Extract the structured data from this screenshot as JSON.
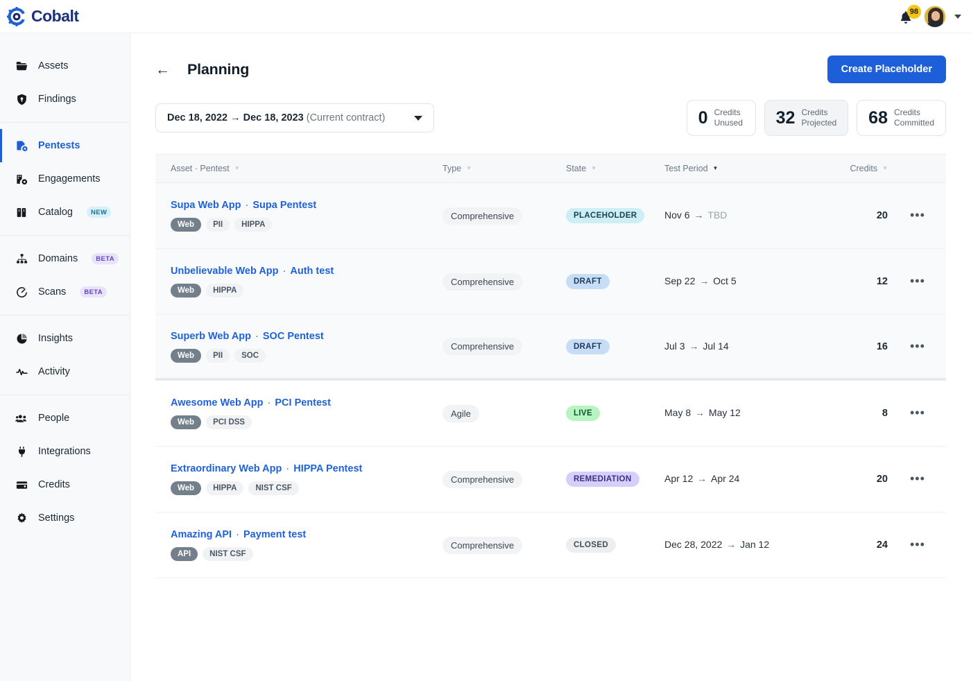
{
  "topbar": {
    "brand_name": "Cobalt",
    "notification_count": "98"
  },
  "sidebar": {
    "groups": [
      {
        "items": [
          {
            "label": "Assets",
            "icon": "folder-icon",
            "active": false,
            "tag": ""
          },
          {
            "label": "Findings",
            "icon": "shield-icon",
            "active": false,
            "tag": ""
          }
        ]
      },
      {
        "items": [
          {
            "label": "Pentests",
            "icon": "pentest-icon",
            "active": true,
            "tag": ""
          },
          {
            "label": "Engagements",
            "icon": "engagements-icon",
            "active": false,
            "tag": ""
          },
          {
            "label": "Catalog",
            "icon": "catalog-icon",
            "active": false,
            "tag": "NEW",
            "tag_kind": "new"
          }
        ]
      },
      {
        "items": [
          {
            "label": "Domains",
            "icon": "sitemap-icon",
            "active": false,
            "tag": "BETA",
            "tag_kind": "beta"
          },
          {
            "label": "Scans",
            "icon": "scan-icon",
            "active": false,
            "tag": "BETA",
            "tag_kind": "beta"
          }
        ]
      },
      {
        "items": [
          {
            "label": "Insights",
            "icon": "pie-chart-icon",
            "active": false,
            "tag": ""
          },
          {
            "label": "Activity",
            "icon": "activity-pulse-icon",
            "active": false,
            "tag": ""
          }
        ]
      },
      {
        "items": [
          {
            "label": "People",
            "icon": "people-icon",
            "active": false,
            "tag": ""
          },
          {
            "label": "Integrations",
            "icon": "plug-icon",
            "active": false,
            "tag": ""
          },
          {
            "label": "Credits",
            "icon": "wallet-icon",
            "active": false,
            "tag": ""
          },
          {
            "label": "Settings",
            "icon": "gear-icon",
            "active": false,
            "tag": ""
          }
        ]
      }
    ]
  },
  "page": {
    "title": "Planning",
    "create_button": "Create Placeholder",
    "date_range_main": "Dec 18, 2022 → Dec 18, 2023",
    "date_range_sub": "(Current contract)"
  },
  "credit_cards": [
    {
      "value": "0",
      "line1": "Credits",
      "line2": "Unused",
      "muted": false
    },
    {
      "value": "32",
      "line1": "Credits",
      "line2": "Projected",
      "muted": true
    },
    {
      "value": "68",
      "line1": "Credits",
      "line2": "Committed",
      "muted": false
    }
  ],
  "table": {
    "columns": [
      {
        "label": "Asset · Pentest",
        "sorted": false
      },
      {
        "label": "Type",
        "sorted": false
      },
      {
        "label": "State",
        "sorted": false
      },
      {
        "label": "Test Period",
        "sorted": true
      },
      {
        "label": "Credits",
        "sorted": false
      }
    ],
    "rows": [
      {
        "asset": "Supa Web App",
        "pentest": "Supa Pentest",
        "tags": [
          {
            "label": "Web",
            "solid": true
          },
          {
            "label": "PII",
            "solid": false
          },
          {
            "label": "HIPPA",
            "solid": false
          }
        ],
        "type": "Comprehensive",
        "state": "PLACEHOLDER",
        "state_class": "st-placeholder",
        "period_start": "Nov 6",
        "period_end": "TBD",
        "period_end_muted": true,
        "credits": "20",
        "shaded": true,
        "group_end": false
      },
      {
        "asset": "Unbelievable Web App",
        "pentest": "Auth test",
        "tags": [
          {
            "label": "Web",
            "solid": true
          },
          {
            "label": "HIPPA",
            "solid": false
          }
        ],
        "type": "Comprehensive",
        "state": "DRAFT",
        "state_class": "st-draft",
        "period_start": "Sep 22",
        "period_end": "Oct 5",
        "period_end_muted": false,
        "credits": "12",
        "shaded": true,
        "group_end": false
      },
      {
        "asset": "Superb Web App",
        "pentest": "SOC Pentest",
        "tags": [
          {
            "label": "Web",
            "solid": true
          },
          {
            "label": "PII",
            "solid": false
          },
          {
            "label": "SOC",
            "solid": false
          }
        ],
        "type": "Comprehensive",
        "state": "DRAFT",
        "state_class": "st-draft",
        "period_start": "Jul 3",
        "period_end": "Jul 14",
        "period_end_muted": false,
        "credits": "16",
        "shaded": true,
        "group_end": true
      },
      {
        "asset": "Awesome Web App",
        "pentest": "PCI Pentest",
        "tags": [
          {
            "label": "Web",
            "solid": true
          },
          {
            "label": "PCI DSS",
            "solid": false
          }
        ],
        "type": "Agile",
        "state": "LIVE",
        "state_class": "st-live",
        "period_start": "May 8",
        "period_end": "May 12",
        "period_end_muted": false,
        "credits": "8",
        "shaded": false,
        "group_end": false
      },
      {
        "asset": "Extraordinary Web App",
        "pentest": "HIPPA Pentest",
        "tags": [
          {
            "label": "Web",
            "solid": true
          },
          {
            "label": "HIPPA",
            "solid": false
          },
          {
            "label": "NIST CSF",
            "solid": false
          }
        ],
        "type": "Comprehensive",
        "state": "REMEDIATION",
        "state_class": "st-remediation",
        "period_start": "Apr 12",
        "period_end": "Apr 24",
        "period_end_muted": false,
        "credits": "20",
        "shaded": false,
        "group_end": false
      },
      {
        "asset": "Amazing API",
        "pentest": "Payment test",
        "tags": [
          {
            "label": "API",
            "solid": true
          },
          {
            "label": "NIST CSF",
            "solid": false
          }
        ],
        "type": "Comprehensive",
        "state": "CLOSED",
        "state_class": "st-closed",
        "period_start": "Dec 28, 2022",
        "period_end": "Jan 12",
        "period_end_muted": false,
        "credits": "24",
        "shaded": false,
        "group_end": false
      }
    ],
    "menu_glyph": "•••"
  },
  "colors": {
    "brand_blue": "#1c3177",
    "accent_blue": "#1d5fd8",
    "link_blue": "#1f62d8",
    "sidebar_bg": "#f7f9fa",
    "badge_yellow": "#f5c518"
  }
}
